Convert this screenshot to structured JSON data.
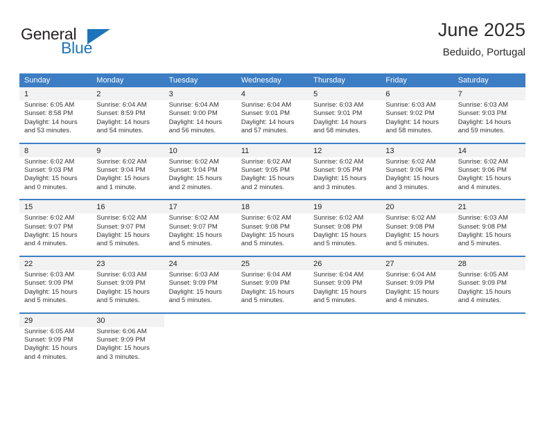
{
  "logo": {
    "word1": "General",
    "word2": "Blue",
    "triangle_color": "#1c74bb",
    "word1_color": "#231f20"
  },
  "header": {
    "title": "June 2025",
    "location": "Beduido, Portugal"
  },
  "calendar": {
    "header_bg": "#3c7dc4",
    "daynum_bg": "#f2f2f2",
    "columns": [
      "Sunday",
      "Monday",
      "Tuesday",
      "Wednesday",
      "Thursday",
      "Friday",
      "Saturday"
    ],
    "weeks": [
      {
        "days": [
          {
            "num": "1",
            "sunrise": "Sunrise: 6:05 AM",
            "sunset": "Sunset: 8:58 PM",
            "daylight_1": "Daylight: 14 hours",
            "daylight_2": "and 53 minutes."
          },
          {
            "num": "2",
            "sunrise": "Sunrise: 6:04 AM",
            "sunset": "Sunset: 8:59 PM",
            "daylight_1": "Daylight: 14 hours",
            "daylight_2": "and 54 minutes."
          },
          {
            "num": "3",
            "sunrise": "Sunrise: 6:04 AM",
            "sunset": "Sunset: 9:00 PM",
            "daylight_1": "Daylight: 14 hours",
            "daylight_2": "and 56 minutes."
          },
          {
            "num": "4",
            "sunrise": "Sunrise: 6:04 AM",
            "sunset": "Sunset: 9:01 PM",
            "daylight_1": "Daylight: 14 hours",
            "daylight_2": "and 57 minutes."
          },
          {
            "num": "5",
            "sunrise": "Sunrise: 6:03 AM",
            "sunset": "Sunset: 9:01 PM",
            "daylight_1": "Daylight: 14 hours",
            "daylight_2": "and 58 minutes."
          },
          {
            "num": "6",
            "sunrise": "Sunrise: 6:03 AM",
            "sunset": "Sunset: 9:02 PM",
            "daylight_1": "Daylight: 14 hours",
            "daylight_2": "and 58 minutes."
          },
          {
            "num": "7",
            "sunrise": "Sunrise: 6:03 AM",
            "sunset": "Sunset: 9:03 PM",
            "daylight_1": "Daylight: 14 hours",
            "daylight_2": "and 59 minutes."
          }
        ]
      },
      {
        "days": [
          {
            "num": "8",
            "sunrise": "Sunrise: 6:02 AM",
            "sunset": "Sunset: 9:03 PM",
            "daylight_1": "Daylight: 15 hours",
            "daylight_2": "and 0 minutes."
          },
          {
            "num": "9",
            "sunrise": "Sunrise: 6:02 AM",
            "sunset": "Sunset: 9:04 PM",
            "daylight_1": "Daylight: 15 hours",
            "daylight_2": "and 1 minute."
          },
          {
            "num": "10",
            "sunrise": "Sunrise: 6:02 AM",
            "sunset": "Sunset: 9:04 PM",
            "daylight_1": "Daylight: 15 hours",
            "daylight_2": "and 2 minutes."
          },
          {
            "num": "11",
            "sunrise": "Sunrise: 6:02 AM",
            "sunset": "Sunset: 9:05 PM",
            "daylight_1": "Daylight: 15 hours",
            "daylight_2": "and 2 minutes."
          },
          {
            "num": "12",
            "sunrise": "Sunrise: 6:02 AM",
            "sunset": "Sunset: 9:05 PM",
            "daylight_1": "Daylight: 15 hours",
            "daylight_2": "and 3 minutes."
          },
          {
            "num": "13",
            "sunrise": "Sunrise: 6:02 AM",
            "sunset": "Sunset: 9:06 PM",
            "daylight_1": "Daylight: 15 hours",
            "daylight_2": "and 3 minutes."
          },
          {
            "num": "14",
            "sunrise": "Sunrise: 6:02 AM",
            "sunset": "Sunset: 9:06 PM",
            "daylight_1": "Daylight: 15 hours",
            "daylight_2": "and 4 minutes."
          }
        ]
      },
      {
        "days": [
          {
            "num": "15",
            "sunrise": "Sunrise: 6:02 AM",
            "sunset": "Sunset: 9:07 PM",
            "daylight_1": "Daylight: 15 hours",
            "daylight_2": "and 4 minutes."
          },
          {
            "num": "16",
            "sunrise": "Sunrise: 6:02 AM",
            "sunset": "Sunset: 9:07 PM",
            "daylight_1": "Daylight: 15 hours",
            "daylight_2": "and 5 minutes."
          },
          {
            "num": "17",
            "sunrise": "Sunrise: 6:02 AM",
            "sunset": "Sunset: 9:07 PM",
            "daylight_1": "Daylight: 15 hours",
            "daylight_2": "and 5 minutes."
          },
          {
            "num": "18",
            "sunrise": "Sunrise: 6:02 AM",
            "sunset": "Sunset: 9:08 PM",
            "daylight_1": "Daylight: 15 hours",
            "daylight_2": "and 5 minutes."
          },
          {
            "num": "19",
            "sunrise": "Sunrise: 6:02 AM",
            "sunset": "Sunset: 9:08 PM",
            "daylight_1": "Daylight: 15 hours",
            "daylight_2": "and 5 minutes."
          },
          {
            "num": "20",
            "sunrise": "Sunrise: 6:02 AM",
            "sunset": "Sunset: 9:08 PM",
            "daylight_1": "Daylight: 15 hours",
            "daylight_2": "and 5 minutes."
          },
          {
            "num": "21",
            "sunrise": "Sunrise: 6:03 AM",
            "sunset": "Sunset: 9:08 PM",
            "daylight_1": "Daylight: 15 hours",
            "daylight_2": "and 5 minutes."
          }
        ]
      },
      {
        "days": [
          {
            "num": "22",
            "sunrise": "Sunrise: 6:03 AM",
            "sunset": "Sunset: 9:09 PM",
            "daylight_1": "Daylight: 15 hours",
            "daylight_2": "and 5 minutes."
          },
          {
            "num": "23",
            "sunrise": "Sunrise: 6:03 AM",
            "sunset": "Sunset: 9:09 PM",
            "daylight_1": "Daylight: 15 hours",
            "daylight_2": "and 5 minutes."
          },
          {
            "num": "24",
            "sunrise": "Sunrise: 6:03 AM",
            "sunset": "Sunset: 9:09 PM",
            "daylight_1": "Daylight: 15 hours",
            "daylight_2": "and 5 minutes."
          },
          {
            "num": "25",
            "sunrise": "Sunrise: 6:04 AM",
            "sunset": "Sunset: 9:09 PM",
            "daylight_1": "Daylight: 15 hours",
            "daylight_2": "and 5 minutes."
          },
          {
            "num": "26",
            "sunrise": "Sunrise: 6:04 AM",
            "sunset": "Sunset: 9:09 PM",
            "daylight_1": "Daylight: 15 hours",
            "daylight_2": "and 5 minutes."
          },
          {
            "num": "27",
            "sunrise": "Sunrise: 6:04 AM",
            "sunset": "Sunset: 9:09 PM",
            "daylight_1": "Daylight: 15 hours",
            "daylight_2": "and 4 minutes."
          },
          {
            "num": "28",
            "sunrise": "Sunrise: 6:05 AM",
            "sunset": "Sunset: 9:09 PM",
            "daylight_1": "Daylight: 15 hours",
            "daylight_2": "and 4 minutes."
          }
        ]
      },
      {
        "days": [
          {
            "num": "29",
            "sunrise": "Sunrise: 6:05 AM",
            "sunset": "Sunset: 9:09 PM",
            "daylight_1": "Daylight: 15 hours",
            "daylight_2": "and 4 minutes."
          },
          {
            "num": "30",
            "sunrise": "Sunrise: 6:06 AM",
            "sunset": "Sunset: 9:09 PM",
            "daylight_1": "Daylight: 15 hours",
            "daylight_2": "and 3 minutes."
          },
          {
            "num": "",
            "sunrise": "",
            "sunset": "",
            "daylight_1": "",
            "daylight_2": ""
          },
          {
            "num": "",
            "sunrise": "",
            "sunset": "",
            "daylight_1": "",
            "daylight_2": ""
          },
          {
            "num": "",
            "sunrise": "",
            "sunset": "",
            "daylight_1": "",
            "daylight_2": ""
          },
          {
            "num": "",
            "sunrise": "",
            "sunset": "",
            "daylight_1": "",
            "daylight_2": ""
          },
          {
            "num": "",
            "sunrise": "",
            "sunset": "",
            "daylight_1": "",
            "daylight_2": ""
          }
        ]
      }
    ]
  }
}
